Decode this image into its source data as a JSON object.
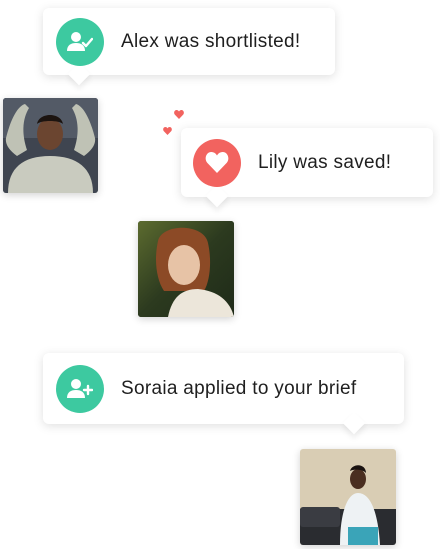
{
  "notifications": [
    {
      "text": "Alex was shortlisted!",
      "icon": "user-check-icon",
      "color": "#3dc9a0"
    },
    {
      "text": "Lily was saved!",
      "icon": "heart-icon",
      "color": "#f2635f"
    },
    {
      "text": "Soraia applied to your brief",
      "icon": "user-plus-icon",
      "color": "#3dc9a0"
    }
  ],
  "photos": [
    {
      "name": "Alex"
    },
    {
      "name": "Lily"
    },
    {
      "name": "Soraia"
    }
  ],
  "accent_red": "#f2635f"
}
